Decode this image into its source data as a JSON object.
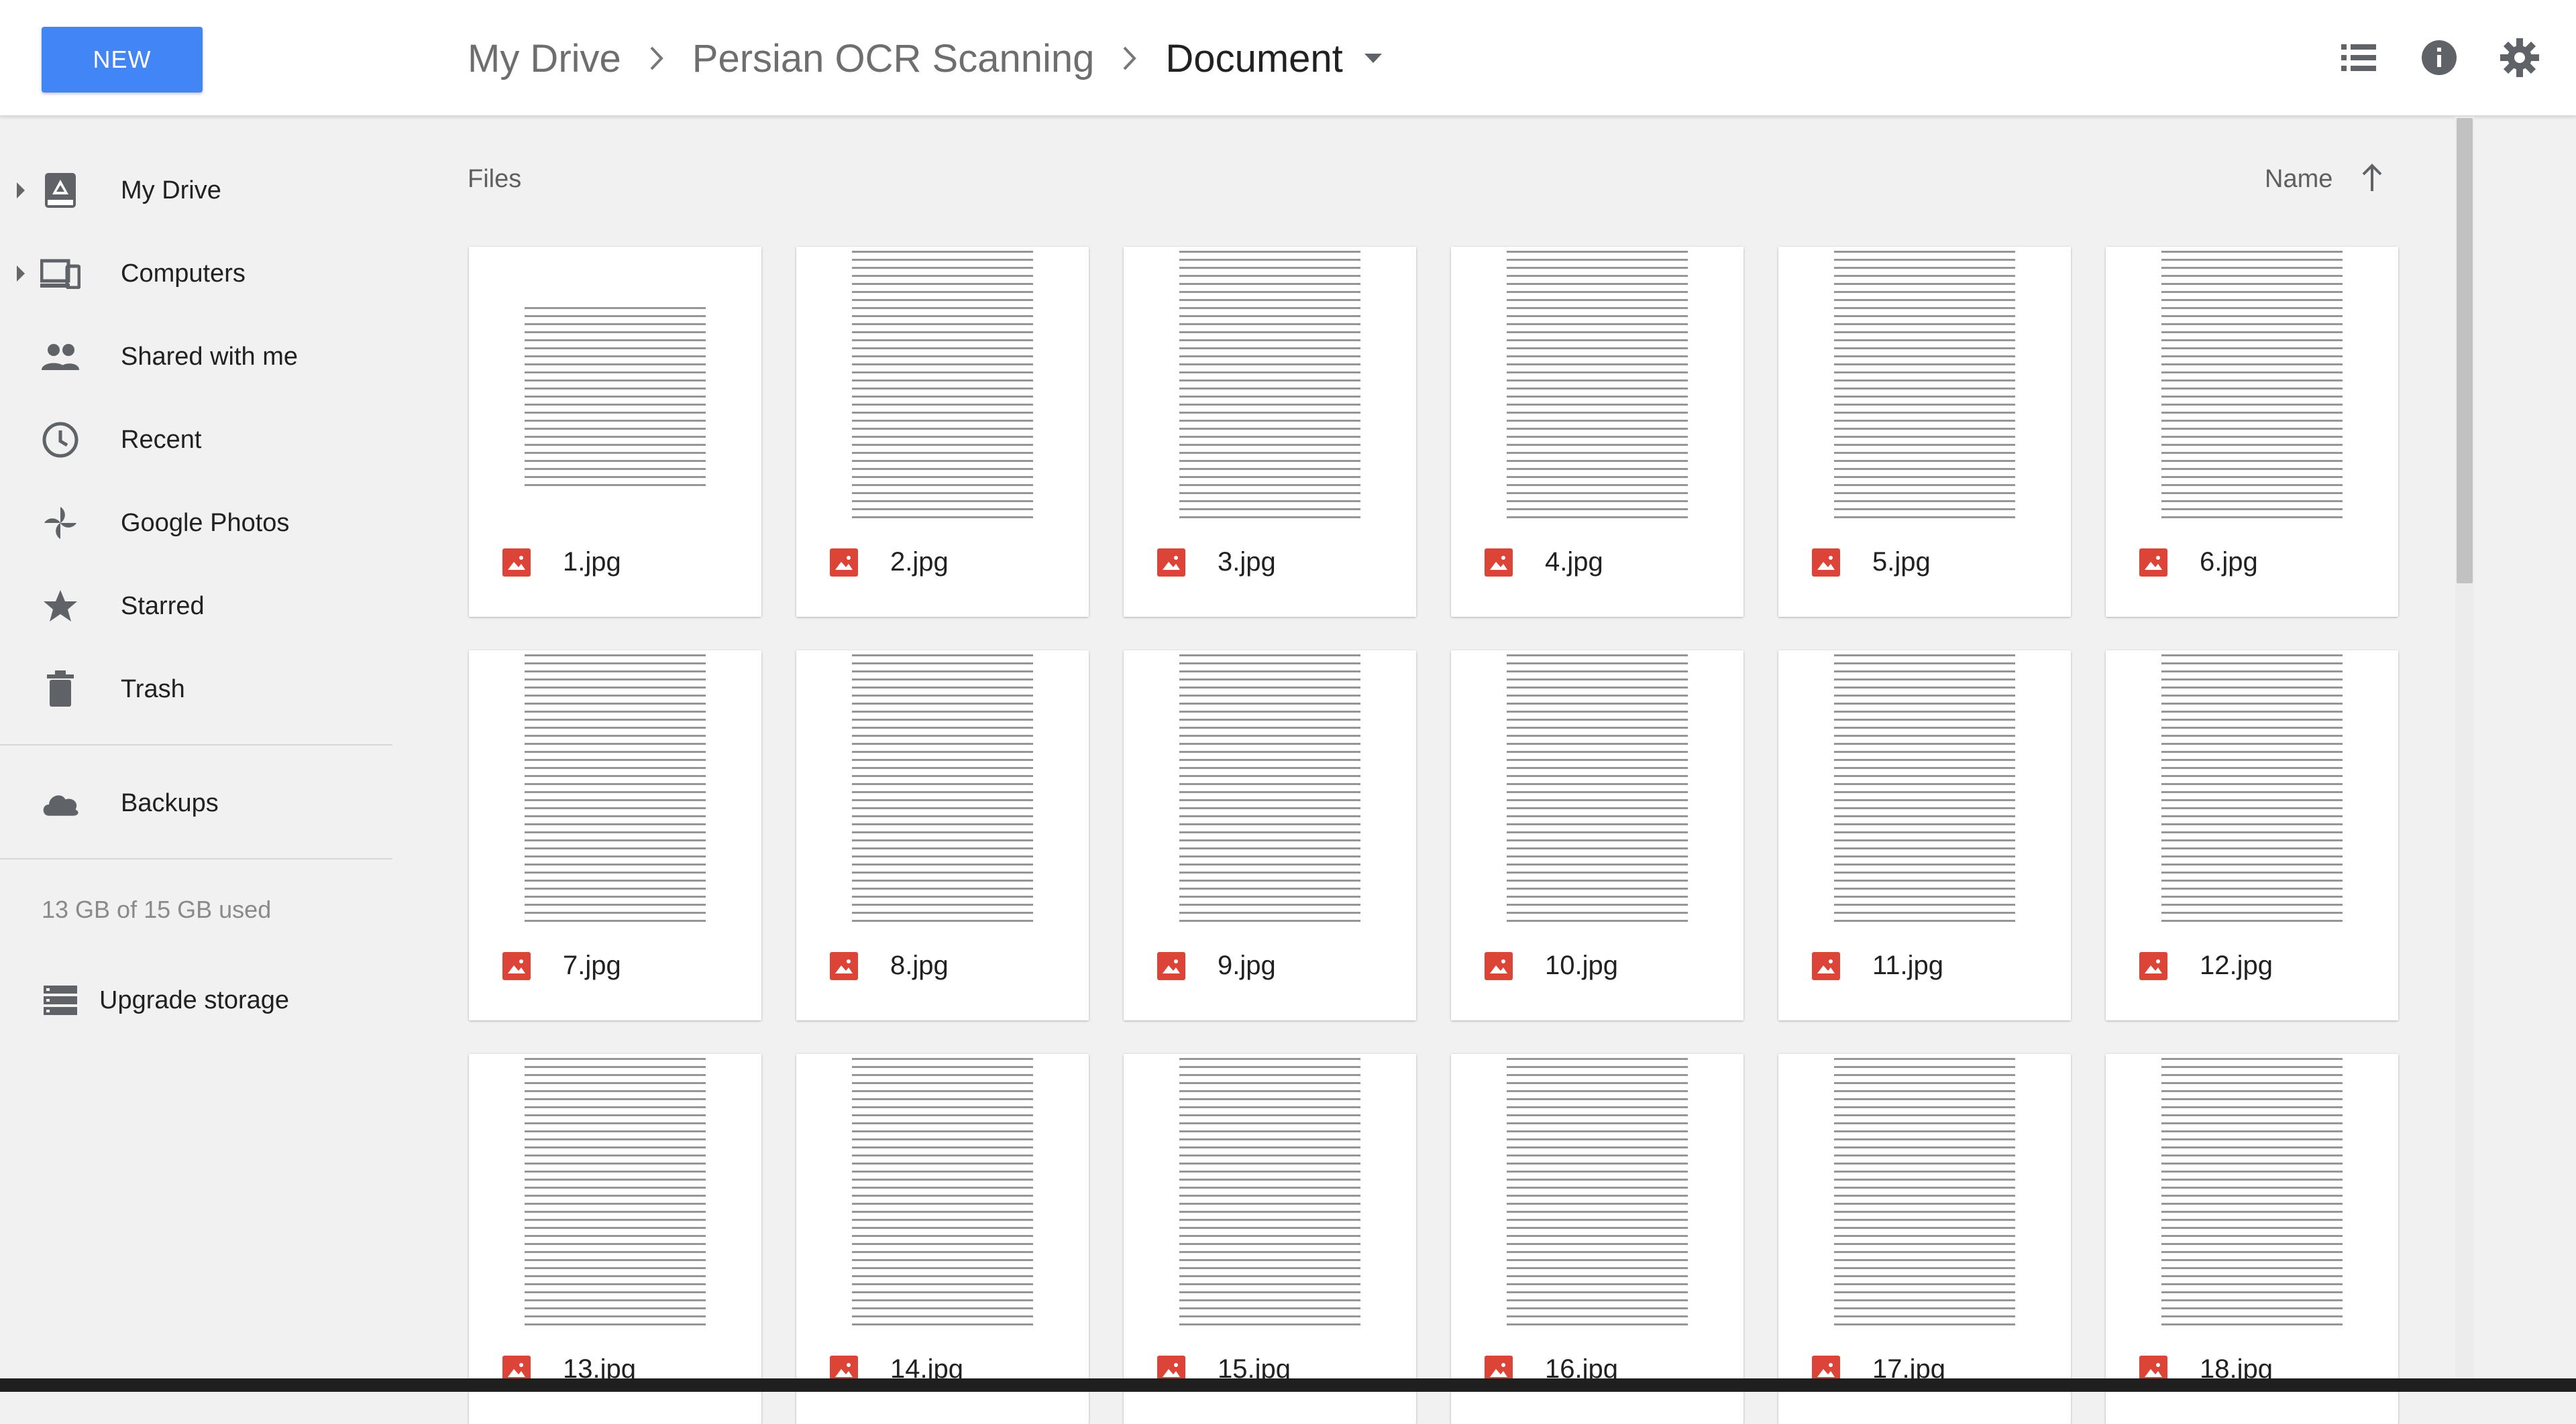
{
  "header": {
    "new_button": "NEW",
    "breadcrumb": [
      "My Drive",
      "Persian OCR Scanning",
      "Document"
    ]
  },
  "sidebar": {
    "items": [
      {
        "label": "My Drive",
        "icon": "drive-icon",
        "expandable": true
      },
      {
        "label": "Computers",
        "icon": "computers-icon",
        "expandable": true
      },
      {
        "label": "Shared with me",
        "icon": "shared-icon",
        "expandable": false
      },
      {
        "label": "Recent",
        "icon": "clock-icon",
        "expandable": false
      },
      {
        "label": "Google Photos",
        "icon": "photos-icon",
        "expandable": false
      },
      {
        "label": "Starred",
        "icon": "star-icon",
        "expandable": false
      },
      {
        "label": "Trash",
        "icon": "trash-icon",
        "expandable": false
      }
    ],
    "backups": "Backups",
    "storage": "13 GB of 15 GB used",
    "upgrade": "Upgrade storage"
  },
  "main": {
    "section_label": "Files",
    "sort_label": "Name",
    "files": [
      "1.jpg",
      "2.jpg",
      "3.jpg",
      "4.jpg",
      "5.jpg",
      "6.jpg",
      "7.jpg",
      "8.jpg",
      "9.jpg",
      "10.jpg",
      "11.jpg",
      "12.jpg",
      "13.jpg",
      "14.jpg",
      "15.jpg",
      "16.jpg",
      "17.jpg",
      "18.jpg"
    ]
  },
  "colors": {
    "accent": "#4285f4",
    "image_file_icon": "#db4437",
    "icon_gray": "#5f6368"
  }
}
